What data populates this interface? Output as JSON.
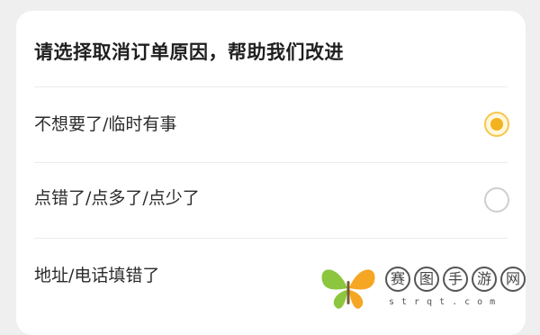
{
  "dialog": {
    "title": "请选择取消订单原因，帮助我们改进"
  },
  "options": [
    {
      "label": "不想要了/临时有事",
      "selected": true
    },
    {
      "label": "点错了/点多了/点少了",
      "selected": false
    },
    {
      "label": "地址/电话填错了",
      "selected": false
    }
  ],
  "watermark": {
    "chars": [
      "赛",
      "图",
      "手",
      "游",
      "网"
    ],
    "url": "strqt.com"
  },
  "colors": {
    "accent": "#f3b21f",
    "radio_border": "#cfcfcf",
    "background": "#efefef",
    "card": "#ffffff"
  }
}
